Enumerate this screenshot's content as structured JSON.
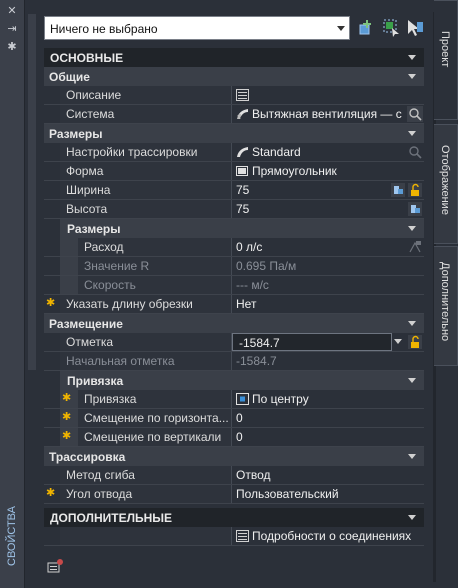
{
  "left_strip": {
    "close_glyph": "✕",
    "pin_glyph": "⇥",
    "settings_glyph": "✱",
    "palette_title": "СВОЙСТВА"
  },
  "selector": {
    "value": "Ничего не выбрано"
  },
  "tabs": [
    "Проект",
    "Отображение",
    "Дополнительно"
  ],
  "sections": {
    "main": "ОСНОВНЫЕ",
    "general": "Общие",
    "sizes": "Размеры",
    "sizes_sub": "Размеры",
    "placement": "Размещение",
    "binding": "Привязка",
    "routing": "Трассировка",
    "extra": "ДОПОЛНИТЕЛЬНЫЕ"
  },
  "props": {
    "description": {
      "name": "Описание",
      "value": ""
    },
    "system": {
      "name": "Система",
      "value": "Вытяжная  вентиляция — с"
    },
    "routing_pref": {
      "name": "Настройки трассировки",
      "value": "Standard"
    },
    "shape": {
      "name": "Форма",
      "value": "Прямоугольник"
    },
    "width": {
      "name": "Ширина",
      "value": "75"
    },
    "height": {
      "name": "Высота",
      "value": "75"
    },
    "flow": {
      "name": "Расход",
      "value": "0 л/с"
    },
    "r_value": {
      "name": "Значение R",
      "value": "0.695 Па/м"
    },
    "velocity": {
      "name": "Скорость",
      "value": "--- м/с"
    },
    "cut_length": {
      "name": "Указать длину обрезки",
      "value": "Нет"
    },
    "elevation": {
      "name": "Отметка",
      "value": "-1584.7"
    },
    "start_elevation": {
      "name": "Начальная отметка",
      "value": "-1584.7"
    },
    "justification": {
      "name": "Привязка",
      "value": "По центру"
    },
    "h_offset": {
      "name": "Смещение  по  горизонта...",
      "value": "0"
    },
    "v_offset": {
      "name": "Смещение по вертикали",
      "value": "0"
    },
    "bend_method": {
      "name": "Метод сгиба",
      "value": "Отвод"
    },
    "bend_angle": {
      "name": "Угол отвода",
      "value": "Пользовательский"
    },
    "connection_details": {
      "name": "",
      "value": "Подробности о соединениях"
    }
  },
  "colors": {
    "background": "#2b3039",
    "section_header": "#3a3f48",
    "main_header": "#202429",
    "asterisk": "#f0b400",
    "accent_blue": "#3a8fd8"
  }
}
